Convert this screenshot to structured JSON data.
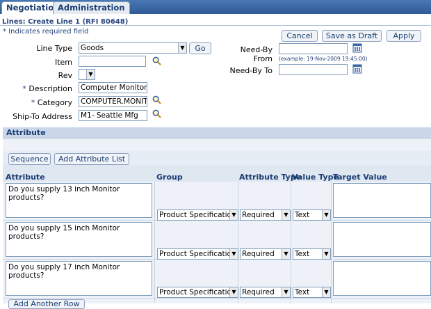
{
  "tabs": [
    {
      "label": "Negotiations",
      "active": true
    },
    {
      "label": "Administration",
      "active": false
    }
  ],
  "page": {
    "title": "Lines: Create Line 1 (RFI 80648)",
    "required_note": "* Indicates required field"
  },
  "actions": {
    "cancel": "Cancel",
    "save_draft": "Save as Draft",
    "apply": "Apply"
  },
  "form": {
    "line_type": {
      "label": "Line Type",
      "value": "Goods",
      "go": "Go"
    },
    "item": {
      "label": "Item",
      "value": ""
    },
    "rev": {
      "label": "Rev",
      "value": ""
    },
    "description": {
      "label": "Description",
      "value": "Computer Monitor Pro"
    },
    "category": {
      "label": "Category",
      "value": "COMPUTER.MONITOR"
    },
    "ship_to": {
      "label": "Ship-To Address",
      "value": "M1- Seattle Mfg"
    },
    "need_by_from": {
      "label": "Need-By From",
      "value": "",
      "hint": "(example: 19-Nov-2009 19:45:00)"
    },
    "need_by_to": {
      "label": "Need-By To",
      "value": ""
    }
  },
  "attribute_section": {
    "title": "Attribute",
    "sequence_button": "Sequence",
    "add_list_button": "Add Attribute List",
    "columns": [
      "Attribute",
      "Group",
      "Attribute Type",
      "Value Type",
      "Target Value"
    ],
    "rows": [
      {
        "attribute": "Do you supply 13 inch Monitor products?",
        "group": "Product Specifications",
        "attribute_type": "Required",
        "value_type": "Text",
        "target": ""
      },
      {
        "attribute": "Do you supply 15 inch Monitor products?",
        "group": "Product Specifications",
        "attribute_type": "Required",
        "value_type": "Text",
        "target": ""
      },
      {
        "attribute": "Do you supply 17 inch Monitor products?",
        "group": "Product Specifications",
        "attribute_type": "Required",
        "value_type": "Text",
        "target": ""
      }
    ],
    "add_row_button": "Add Another Row"
  },
  "colors": {
    "header_blue": "#2f5a96",
    "section_bg": "#c9d7e8",
    "link_blue": "#1b3e75"
  }
}
